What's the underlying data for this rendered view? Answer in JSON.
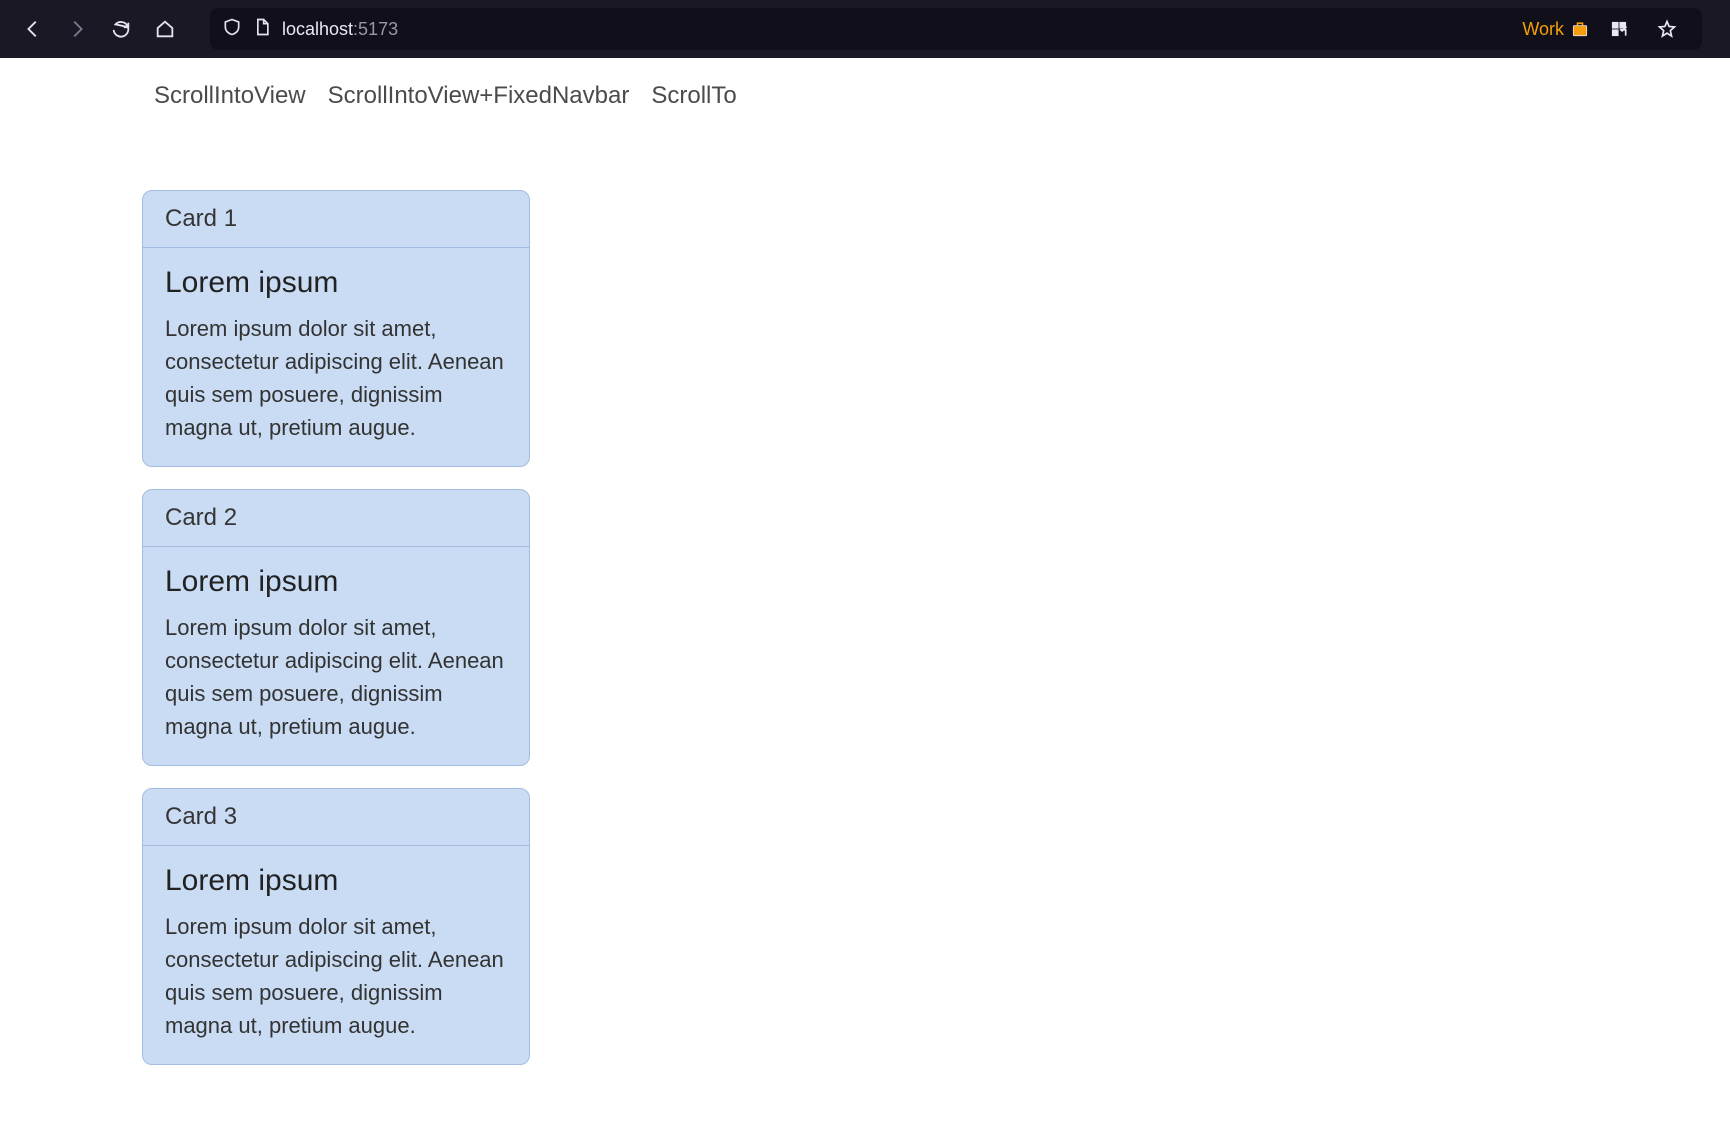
{
  "browser": {
    "url_host": "localhost",
    "url_port": ":5173",
    "work_label": "Work"
  },
  "nav": {
    "links": [
      {
        "label": "ScrollIntoView"
      },
      {
        "label": "ScrollIntoView+FixedNavbar"
      },
      {
        "label": "ScrollTo"
      }
    ]
  },
  "cards": [
    {
      "header": "Card 1",
      "title": "Lorem ipsum",
      "body": "Lorem ipsum dolor sit amet, consectetur adipiscing elit. Aenean quis sem posuere, dignissim magna ut, pretium augue."
    },
    {
      "header": "Card 2",
      "title": "Lorem ipsum",
      "body": "Lorem ipsum dolor sit amet, consectetur adipiscing elit. Aenean quis sem posuere, dignissim magna ut, pretium augue."
    },
    {
      "header": "Card 3",
      "title": "Lorem ipsum",
      "body": "Lorem ipsum dolor sit amet, consectetur adipiscing elit. Aenean quis sem posuere, dignissim magna ut, pretium augue."
    }
  ]
}
